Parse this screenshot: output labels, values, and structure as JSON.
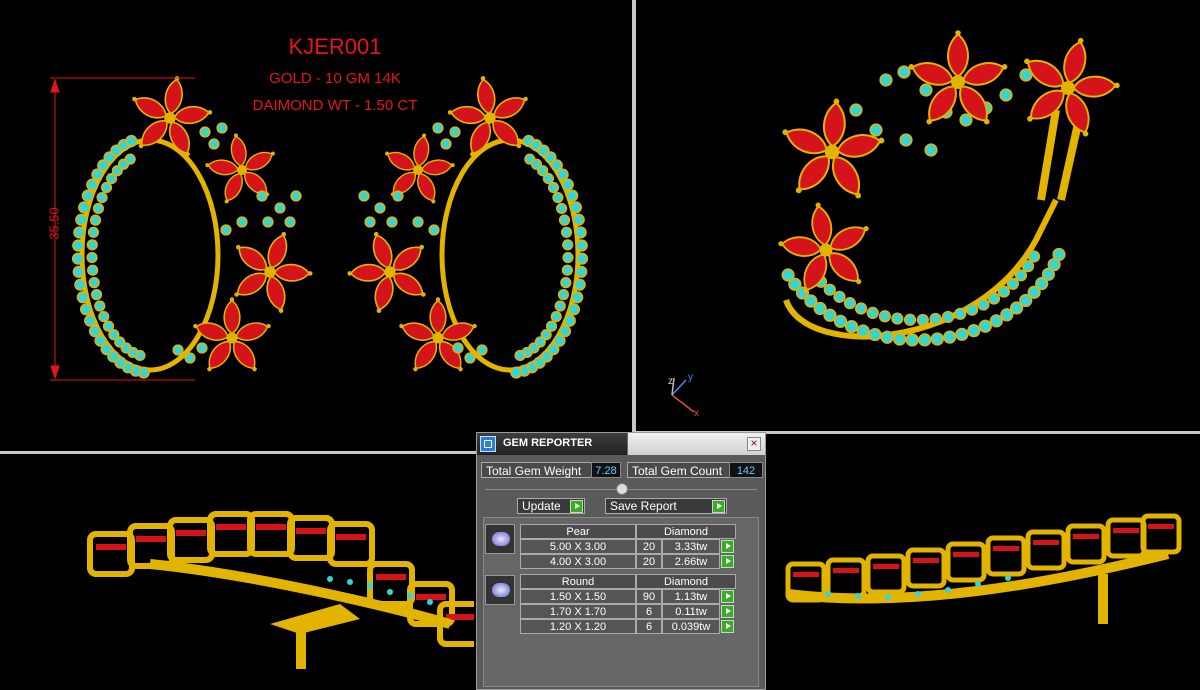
{
  "design": {
    "code": "KJER001",
    "gold": "GOLD - 10 GM 14K",
    "diamond": "DAIMOND WT - 1.50 CT",
    "height_dimension": "35.50"
  },
  "axis_labels": {
    "x": "x",
    "y": "y",
    "z": "z"
  },
  "gem_reporter": {
    "title": "GEM REPORTER",
    "close": "×",
    "total_weight_label": "Total Gem Weight",
    "total_weight_value": "7.28",
    "total_count_label": "Total Gem Count",
    "total_count_value": "142",
    "update_label": "Update",
    "save_label": "Save Report",
    "groups": [
      {
        "shape": "Pear",
        "type": "Diamond",
        "rows": [
          {
            "size": "5.00 X 3.00",
            "count": "20",
            "weight": "3.33tw"
          },
          {
            "size": "4.00 X 3.00",
            "count": "20",
            "weight": "2.66tw"
          }
        ]
      },
      {
        "shape": "Round",
        "type": "Diamond",
        "rows": [
          {
            "size": "1.50 X 1.50",
            "count": "90",
            "weight": "1.13tw"
          },
          {
            "size": "1.70 X 1.70",
            "count": "6",
            "weight": "0.11tw"
          },
          {
            "size": "1.20 X 1.20",
            "count": "6",
            "weight": "0.039tw"
          }
        ]
      }
    ]
  },
  "colors": {
    "gold": "#e2b400",
    "ruby": "#d4141a",
    "turquoise": "#32d6d8",
    "dimension": "#e8141b",
    "panel": "#5a5a5a"
  }
}
